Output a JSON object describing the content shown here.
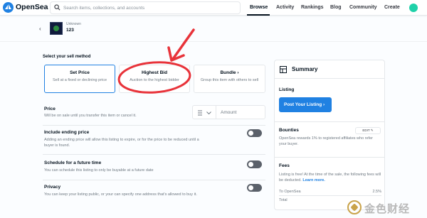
{
  "nav": {
    "logo_text": "OpenSea",
    "search_placeholder": "Search items, collections, and accounts",
    "links": [
      "Browse",
      "Activity",
      "Rankings",
      "Blog",
      "Community",
      "Create"
    ],
    "active_link": "Browse"
  },
  "item": {
    "collection": "Unknown",
    "name": "123"
  },
  "sell": {
    "section_title": "Select your sell method",
    "methods": [
      {
        "title": "Set Price",
        "subtitle": "Sell at a fixed or declining price",
        "selected": true
      },
      {
        "title": "Highest Bid",
        "subtitle": "Auction to the highest bidder",
        "selected": false
      },
      {
        "title": "Bundle",
        "subtitle": "Group this item with others to sell",
        "selected": false
      }
    ]
  },
  "price": {
    "title": "Price",
    "description": "Will be on sale until you transfer this item or cancel it.",
    "amount_placeholder": "Amount"
  },
  "options": [
    {
      "title": "Include ending price",
      "description": "Adding an ending price will allow this listing to expire, or for the price to be reduced until a buyer is found.",
      "enabled": false
    },
    {
      "title": "Schedule for a future time",
      "description": "You can schedule this listing to only be buyable at a future date",
      "enabled": false
    },
    {
      "title": "Privacy",
      "description": "You can keep your listing public, or your can specify one address that's allowed to buy it.",
      "enabled": false
    }
  ],
  "summary": {
    "title": "Summary",
    "listing_label": "Listing",
    "post_button": "Post Your Listing",
    "bounties_label": "Bounties",
    "edit_label": "EDIT",
    "bounties_text": "OpenSea rewards 1% to registered affiliates who refer your buyer.",
    "fees_label": "Fees",
    "fees_text": "Listing is free! At the time of the sale, the following fees will be deducted.",
    "learn_more": "Learn more.",
    "fee_rows": [
      {
        "label": "To OpenSea",
        "value": "2.5%"
      },
      {
        "label": "Total",
        "value": ""
      }
    ]
  },
  "watermark": {
    "text": "金色财经"
  },
  "colors": {
    "accent": "#2081e2",
    "annotation": "#e8333a",
    "toggle_off": "#5b616a"
  }
}
